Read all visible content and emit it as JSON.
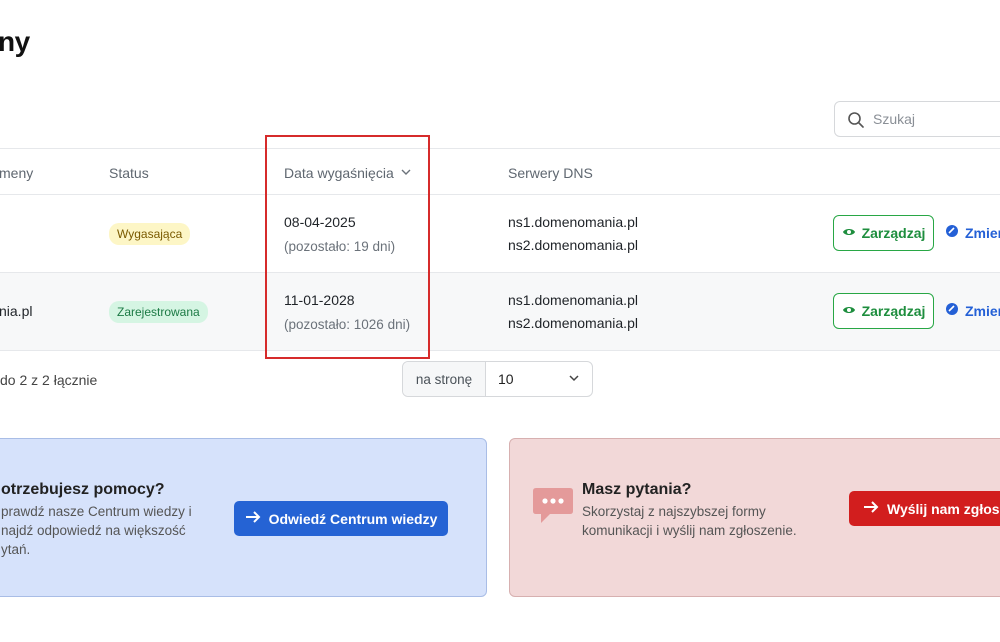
{
  "page": {
    "title": "ny"
  },
  "search": {
    "placeholder": "Szukaj",
    "icon": "search-icon"
  },
  "table": {
    "headers": {
      "name": "meny",
      "status": "Status",
      "expiry": "Data wygaśnięcia",
      "dns": "Serwery DNS"
    },
    "rows": [
      {
        "name": "",
        "status": "Wygasająca",
        "expiry_date": "08-04-2025",
        "remaining": "(pozostało: 19 dni)",
        "dns1": "ns1.domenomania.pl",
        "dns2": "ns2.domenomania.pl",
        "manage_label": "Zarządzaj",
        "change_label": "Zmień"
      },
      {
        "name": "nia.pl",
        "status": "Zarejestrowana",
        "expiry_date": "11-01-2028",
        "remaining": "(pozostało: 1026 dni)",
        "dns1": "ns1.domenomania.pl",
        "dns2": "ns2.domenomania.pl",
        "manage_label": "Zarządzaj",
        "change_label": "Zmień"
      }
    ]
  },
  "pagination": {
    "info": "do 2 z 2 łącznie",
    "per_page_label": "na stronę",
    "per_page_value": "10"
  },
  "help_card": {
    "title": "otrzebujesz pomocy?",
    "line1": "prawdź nasze Centrum wiedzy i",
    "line2": "najdź odpowiedź na większość",
    "line3": "ytań.",
    "button": "Odwiedź Centrum wiedzy"
  },
  "contact_card": {
    "title": "Masz pytania?",
    "line1": "Skorzystaj z najszybszej formy",
    "line2": "komunikacji i wyślij nam zgłoszenie.",
    "button": "Wyślij nam zgłoszenie"
  },
  "colors": {
    "accent_green": "#1e8e3e",
    "accent_blue": "#2563d4",
    "accent_red": "#d21e1e",
    "highlight_border": "#d62b2b"
  }
}
